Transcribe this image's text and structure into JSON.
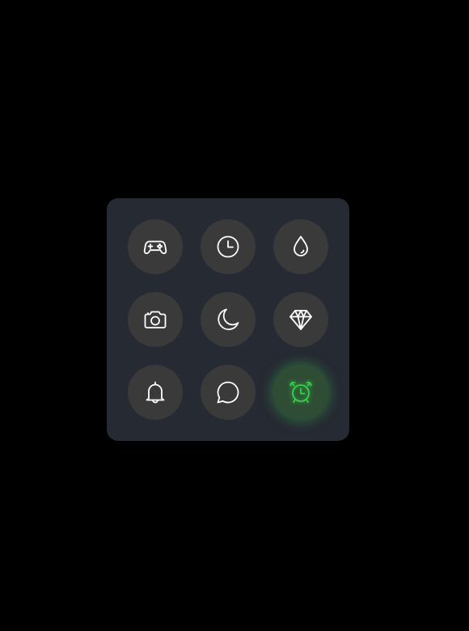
{
  "theme": {
    "page_background": "#000000",
    "panel_background": "#262a33",
    "tile_background": "#3a3a3b",
    "icon_color": "#ffffff",
    "active_color": "#35d04a"
  },
  "grid": {
    "tiles": [
      {
        "icon": "gamepad-icon",
        "active": false
      },
      {
        "icon": "clock-icon",
        "active": false
      },
      {
        "icon": "water-drop-icon",
        "active": false
      },
      {
        "icon": "camera-icon",
        "active": false
      },
      {
        "icon": "moon-icon",
        "active": false
      },
      {
        "icon": "diamond-icon",
        "active": false
      },
      {
        "icon": "bell-icon",
        "active": false
      },
      {
        "icon": "chat-bubble-icon",
        "active": false
      },
      {
        "icon": "alarm-clock-icon",
        "active": true
      }
    ]
  }
}
